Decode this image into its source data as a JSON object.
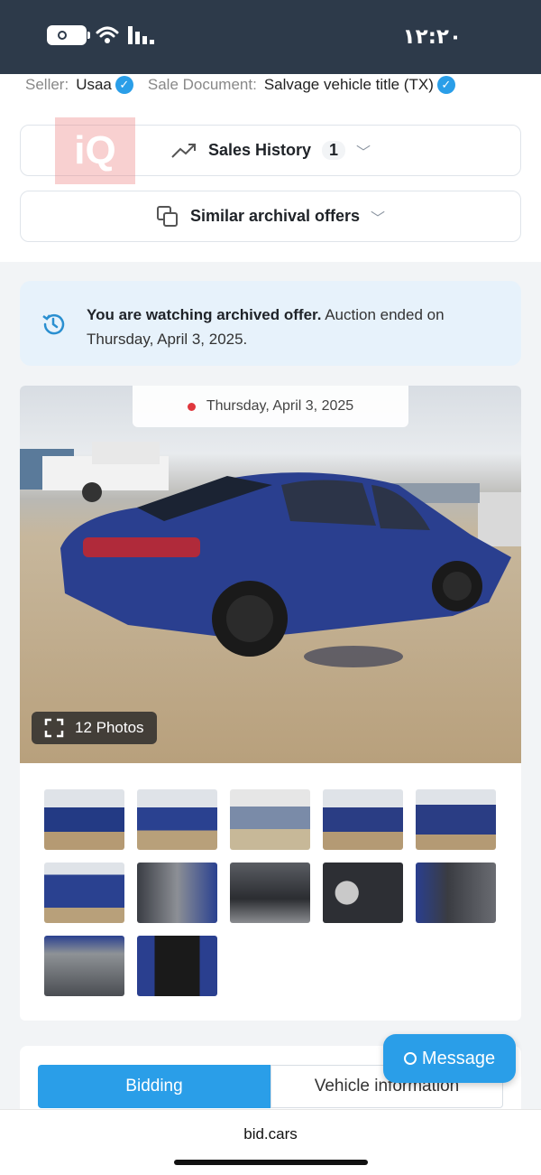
{
  "status_bar": {
    "time": "۱۲:۲۰"
  },
  "seller": {
    "seller_label": "Seller:",
    "seller_value": "Usaa",
    "doc_label": "Sale Document:",
    "doc_value": "Salvage vehicle title (TX)"
  },
  "sales_history": {
    "label": "Sales History",
    "count": "1"
  },
  "similar": {
    "label": "Similar archival offers"
  },
  "watermark": "iQ",
  "notice": {
    "bold": "You are watching archived offer.",
    "text": " Auction ended on Thursday, April 3, 2025."
  },
  "photo": {
    "date": "Thursday, April 3, 2025",
    "photos_count": "12 Photos"
  },
  "tabs": {
    "bidding": "Bidding",
    "vehicle": "Vehicle information"
  },
  "message_button": "Message",
  "browser": {
    "url": "bid.cars"
  },
  "colors": {
    "accent": "#2a9ee8",
    "notice_bg": "#e7f2fb",
    "status_bar": "#2d3a4a"
  }
}
